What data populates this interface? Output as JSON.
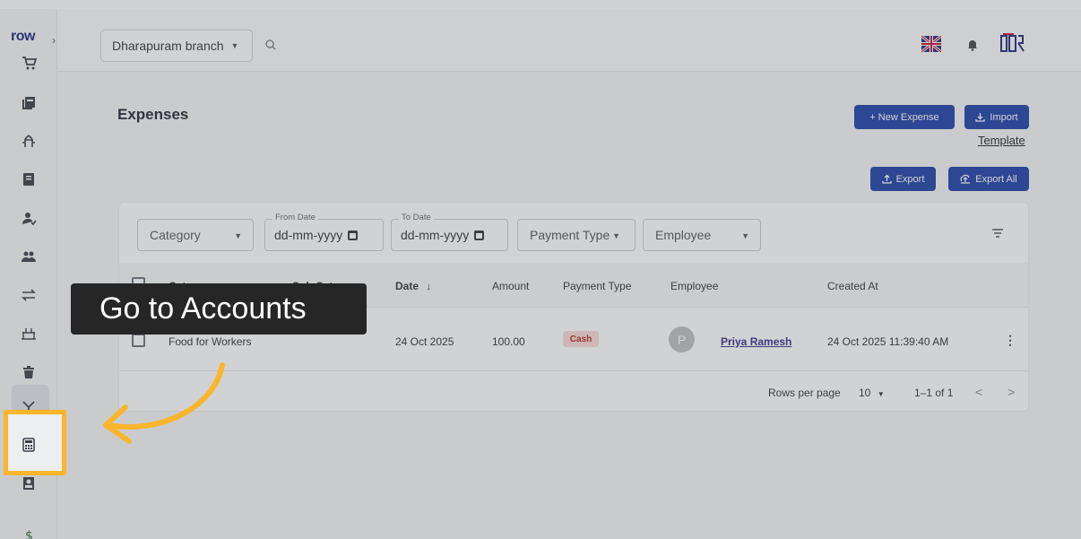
{
  "sidebar": {
    "logo": "row",
    "expand_icon": "chevron-right-icon",
    "items": [
      {
        "name": "pos-icon"
      },
      {
        "name": "copy-icon"
      },
      {
        "name": "dining-icon"
      },
      {
        "name": "menu-book-icon"
      },
      {
        "name": "user-icon"
      },
      {
        "name": "users-icon"
      },
      {
        "name": "transfer-icon"
      },
      {
        "name": "inventory-icon"
      },
      {
        "name": "trash-icon"
      },
      {
        "name": "fork-icon"
      },
      {
        "name": "calculator-icon"
      },
      {
        "name": "person-card-icon"
      },
      {
        "name": "money-icon"
      }
    ]
  },
  "topbar": {
    "branch": "Dharapuram branch",
    "search_icon": "search-icon",
    "flag_icon": "uk-flag-icon",
    "bell_icon": "bell-icon",
    "brand_icon": "brand-logo-icon"
  },
  "page": {
    "title": "Expenses",
    "new_expense": "+ New Expense",
    "import": "Import",
    "template": "Template",
    "export": "Export",
    "export_all": "Export All"
  },
  "filters": {
    "category": "Category",
    "from_label": "From Date",
    "from_value": "dd-mm-yyyy",
    "to_label": "To Date",
    "to_value": "dd-mm-yyyy",
    "payment_type": "Payment Type",
    "employee": "Employee"
  },
  "table": {
    "headers": [
      "Category",
      "Sub Category",
      "Date",
      "Amount",
      "Payment Type",
      "Employee",
      "Created At"
    ],
    "sort_indicator": "↓",
    "rows": [
      {
        "category": "Food for Workers",
        "sub_category": "",
        "date": "24 Oct 2025",
        "amount": "100.00",
        "payment_type": "Cash",
        "employee_initial": "P",
        "employee": "Priya Ramesh",
        "created_at": "24 Oct 2025 11:39:40 AM"
      }
    ]
  },
  "pagination": {
    "rows_per_page_label": "Rows per page",
    "rows_per_page": "10",
    "range": "1–1 of 1",
    "prev": "<",
    "next": ">"
  },
  "callout": {
    "text": "Go to Accounts",
    "highlight_color": "#fbb52b"
  },
  "colors": {
    "primary": "#1c3fa8",
    "cash_bg": "#f9d8d8",
    "cash_text": "#b3261e"
  }
}
